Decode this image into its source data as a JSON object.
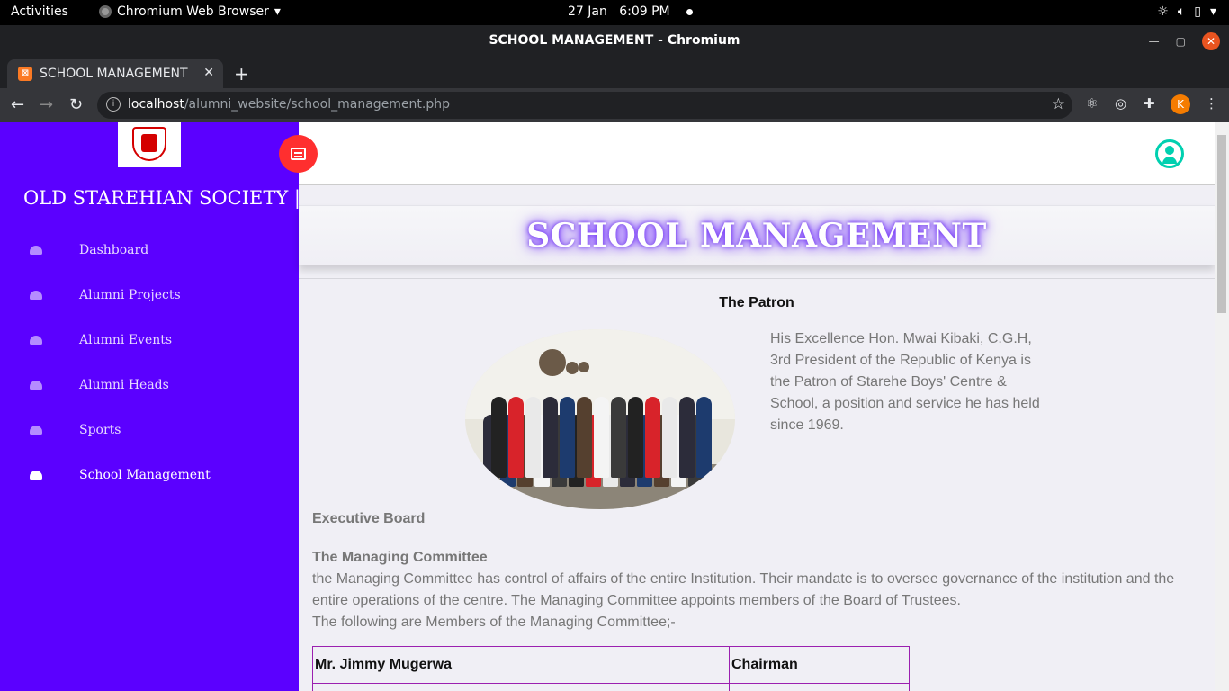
{
  "os_bar": {
    "activities": "Activities",
    "app_name": "Chromium Web Browser",
    "date": "27 Jan",
    "time": "6:09 PM"
  },
  "window": {
    "title": "SCHOOL MANAGEMENT - Chromium"
  },
  "browser": {
    "tab_title": "SCHOOL MANAGEMENT",
    "url_host": "localhost",
    "url_path": "/alumni_website/school_management.php",
    "profile_initial": "K"
  },
  "sidebar": {
    "brand": "OLD STAREHIAN SOCIETY |",
    "items": [
      {
        "label": "Dashboard"
      },
      {
        "label": "Alumni Projects"
      },
      {
        "label": "Alumni Events"
      },
      {
        "label": "Alumni Heads"
      },
      {
        "label": "Sports"
      },
      {
        "label": "School Management"
      }
    ]
  },
  "main": {
    "page_title": "SCHOOL MANAGEMENT",
    "patron_heading": "The Patron",
    "patron_text": "His Excellence Hon. Mwai Kibaki, C.G.H, 3rd President of the Republic of Kenya is the Patron of Starehe Boys' Centre & School, a position and service he has held since 1969.",
    "executive_board": "Executive Board",
    "committee_heading": "The Managing Committee",
    "committee_text": "the Managing Committee has control of affairs of the entire Institution. Their mandate is to oversee governance of the institution and the entire operations of the centre. The Managing Committee appoints members of the Board of Trustees.",
    "committee_members_intro": "The following are Members of the Managing Committee;-",
    "members": [
      {
        "name": "Mr. Jimmy Mugerwa",
        "role": "Chairman"
      }
    ]
  },
  "colors": {
    "sidebar_bg": "#5b00ff",
    "toggle_btn": "#ff2f2f",
    "user_icon": "#00d0b0",
    "table_border": "#9b1fb0"
  }
}
